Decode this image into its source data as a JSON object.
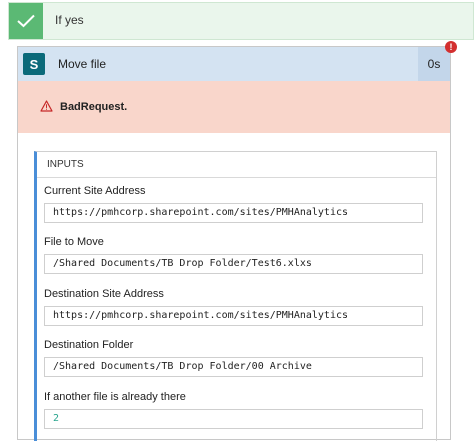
{
  "condition": {
    "label": "If yes"
  },
  "action": {
    "title": "Move file",
    "duration": "0s",
    "error_badge": "!",
    "error_message": "BadRequest."
  },
  "inputs": {
    "title": "INPUTS",
    "fields": [
      {
        "label": "Current Site Address",
        "value": "https://pmhcorp.sharepoint.com/sites/PMHAnalytics"
      },
      {
        "label": "File to Move",
        "value": "/Shared Documents/TB Drop Folder/Test6.xlxs"
      },
      {
        "label": "Destination Site Address",
        "value": "https://pmhcorp.sharepoint.com/sites/PMHAnalytics"
      },
      {
        "label": "Destination Folder",
        "value": "/Shared Documents/TB Drop Folder/00 Archive"
      },
      {
        "label": "If another file is already there",
        "value": "2"
      }
    ]
  },
  "colors": {
    "success_green": "#5bb974",
    "header_blue": "#d4e3f2",
    "error_bg": "#f9d6cb",
    "error_red": "#d32f2f",
    "inputs_accent": "#4a8ed8"
  }
}
